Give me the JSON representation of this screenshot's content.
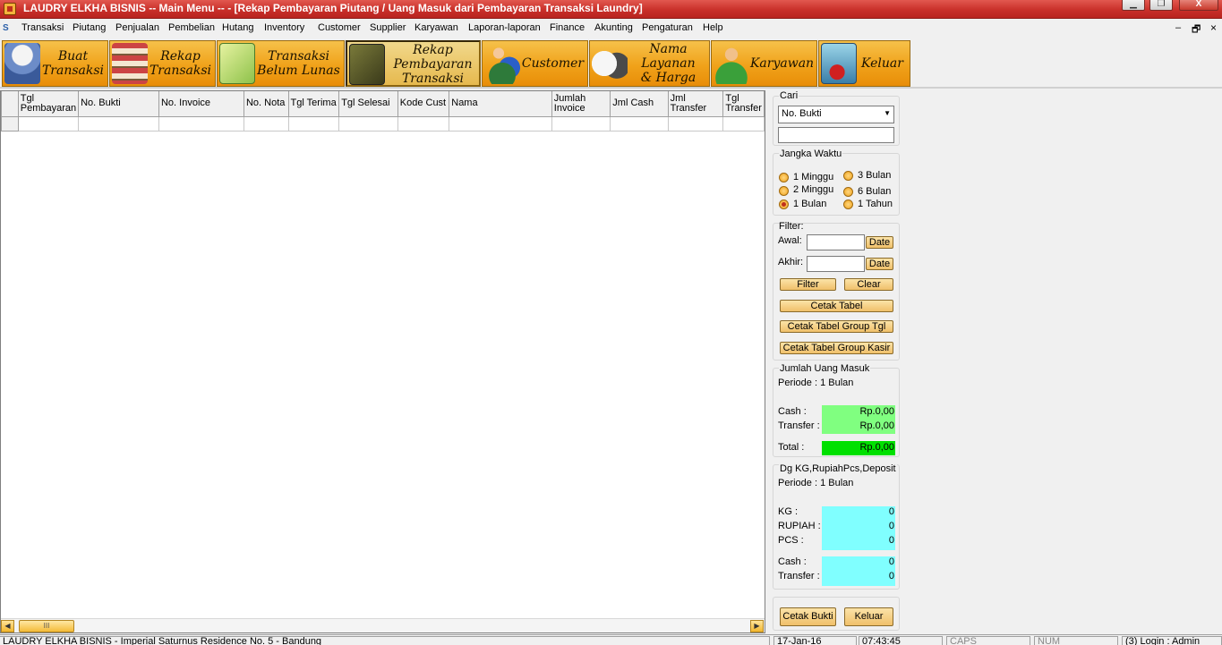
{
  "window": {
    "title": "LAUDRY ELKHA BISNIS  -- Main Menu -- - [Rekap Pembayaran Piutang / Uang Masuk dari Pembayaran Transaksi Laundry]",
    "minimize_glyph": "▁",
    "maximize_glyph": "❐",
    "close_glyph": "X"
  },
  "menu": {
    "items": [
      "Transaksi",
      "Piutang",
      "Penjualan",
      "Pembelian",
      "Hutang",
      "Inventory",
      "Customer",
      "Supplier",
      "Karyawan",
      "Laporan-laporan",
      "Finance",
      "Akunting",
      "Pengaturan",
      "Help"
    ],
    "mdi_min": "–",
    "mdi_restore": "🗗",
    "mdi_close": "×"
  },
  "toolbar": {
    "buttons": [
      {
        "label": "Buat\nTransaksi",
        "icon": "laundry-basket-icon"
      },
      {
        "label": "Rekap\nTransaksi",
        "icon": "shelf-icon"
      },
      {
        "label": "Transaksi\nBelum Lunas",
        "icon": "calculator-icon"
      },
      {
        "label": "Rekap\nPembayaran\nTransaksi",
        "icon": "card-terminal-icon"
      },
      {
        "label": "Customer",
        "icon": "customer-people-icon"
      },
      {
        "label": "Nama\nLayanan\n& Harga",
        "icon": "tshirt-icon"
      },
      {
        "label": "Karyawan",
        "icon": "employee-icon"
      },
      {
        "label": "Keluar",
        "icon": "exit-building-icon"
      }
    ]
  },
  "table": {
    "columns": [
      "Tgl Pembayaran",
      "No. Bukti",
      "No. Invoice",
      "No. Nota",
      "Tgl Terima",
      "Tgl Selesai",
      "Kode Cust",
      "Nama",
      "Jumlah Invoice",
      "Jml Cash",
      "Jml Transfer",
      "Tgl Transfer"
    ],
    "rows": [],
    "scroll_thumb_glyph": "III",
    "scroll_left_glyph": "◀",
    "scroll_right_glyph": "▶"
  },
  "cari": {
    "title": "Cari",
    "selected": "No. Bukti",
    "dropdown_glyph": "▼",
    "text_value": ""
  },
  "jangka_waktu": {
    "title": "Jangka Waktu",
    "options": [
      "1 Minggu",
      "2 Minggu",
      "1 Bulan",
      "3 Bulan",
      "6 Bulan",
      "1 Tahun"
    ],
    "selected": "1 Bulan"
  },
  "filter": {
    "title": "Filter:",
    "awal_label": "Awal:",
    "akhir_label": "Akhir:",
    "awal_value": "",
    "akhir_value": "",
    "date_button": "Date",
    "filter_button": "Filter",
    "clear_button": "Clear",
    "cetak_tabel": "Cetak Tabel",
    "cetak_group_tgl": "Cetak Tabel Group Tgl",
    "cetak_group_kasir": "Cetak Tabel Group Kasir"
  },
  "uang_masuk": {
    "title": "Jumlah Uang Masuk",
    "periode": "Periode : 1 Bulan",
    "cash_label": "Cash :",
    "cash_value": "Rp.0,00",
    "transfer_label": "Transfer :",
    "transfer_value": "Rp.0,00",
    "total_label": "Total :",
    "total_value": "Rp.0,00",
    "colors": {
      "cash": "#80ff80",
      "transfer": "#80ff80",
      "total": "#00e000"
    }
  },
  "deposit": {
    "title": "Dg KG,RupiahPcs,Deposit",
    "periode": "Periode : 1 Bulan",
    "kg_label": "KG :",
    "kg_value": "0",
    "rupiah_label": "RUPIAH :",
    "rupiah_value": "0",
    "pcs_label": "PCS :",
    "pcs_value": "0",
    "cash_label": "Cash :",
    "cash_value": "0",
    "transfer_label": "Transfer :",
    "transfer_value": "0",
    "color": "#80ffff"
  },
  "actions": {
    "cetak_bukti": "Cetak Bukti",
    "keluar": "Keluar"
  },
  "status": {
    "address": "LAUDRY ELKHA BISNIS - Imperial Saturnus Residence No. 5 - Bandung",
    "date": "17-Jan-16",
    "time": "07:43:45",
    "caps": "CAPS",
    "num": "NUM",
    "login": "(3) Login : Admin"
  }
}
